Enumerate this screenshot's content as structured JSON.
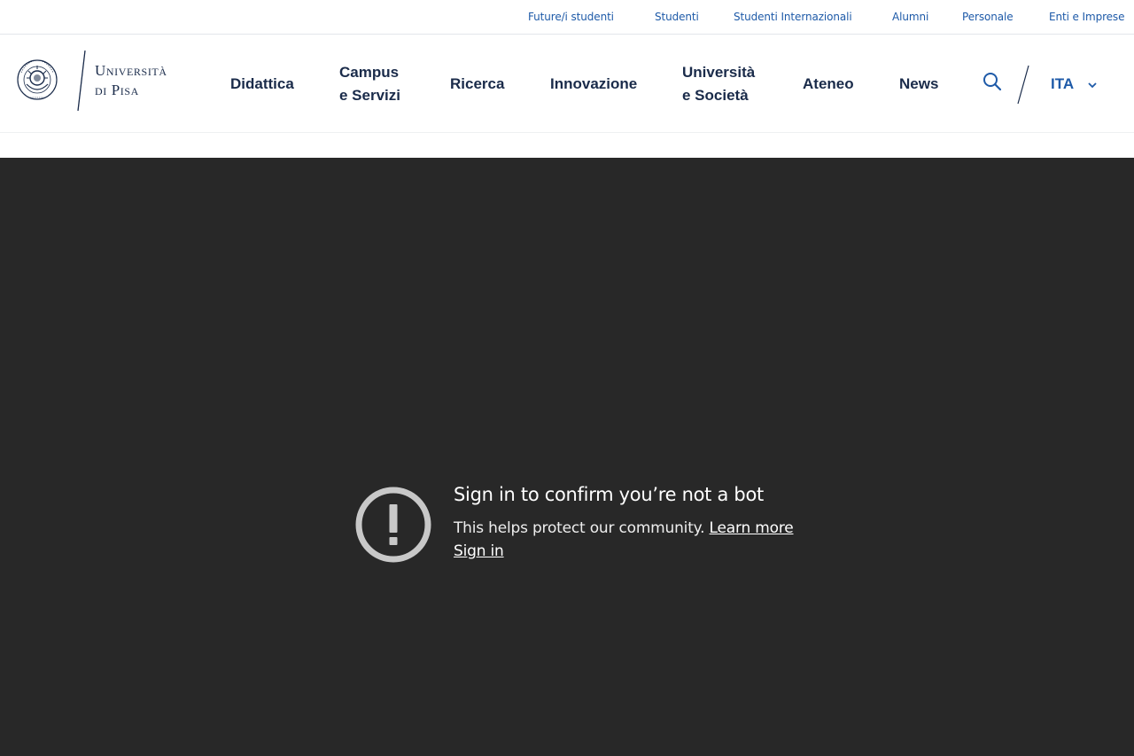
{
  "utility_nav": [
    {
      "label": "Future/i studenti"
    },
    {
      "label": "Studenti"
    },
    {
      "label": "Studenti Internazionali"
    },
    {
      "label": "Alumni"
    },
    {
      "label": "Personale"
    },
    {
      "label": "Enti e Imprese"
    }
  ],
  "logo": {
    "line1": "Università",
    "line2": "di Pisa",
    "seal_text": "IN SVPREMÆ DIGNITATIS",
    "seal_year": "1343"
  },
  "main_nav": [
    {
      "line1": "Didattica",
      "line2": ""
    },
    {
      "line1": "Campus",
      "line2": "e Servizi"
    },
    {
      "line1": "Ricerca",
      "line2": ""
    },
    {
      "line1": "Innovazione",
      "line2": ""
    },
    {
      "line1": "Università",
      "line2": "e Società"
    },
    {
      "line1": "Ateneo",
      "line2": ""
    },
    {
      "line1": "News",
      "line2": ""
    }
  ],
  "language": {
    "selected": "ITA"
  },
  "icons": {
    "search": "search-icon",
    "chevron": "chevron-down-icon",
    "alert": "alert-circle-icon"
  },
  "colors": {
    "link_blue": "#1e5aa8",
    "navy": "#1a2b4a",
    "video_bg": "#282828"
  },
  "video_message": {
    "title": "Sign in to confirm you’re not a bot",
    "body": "This helps protect our community.",
    "learn_more": "Learn more",
    "sign_in": "Sign in"
  }
}
